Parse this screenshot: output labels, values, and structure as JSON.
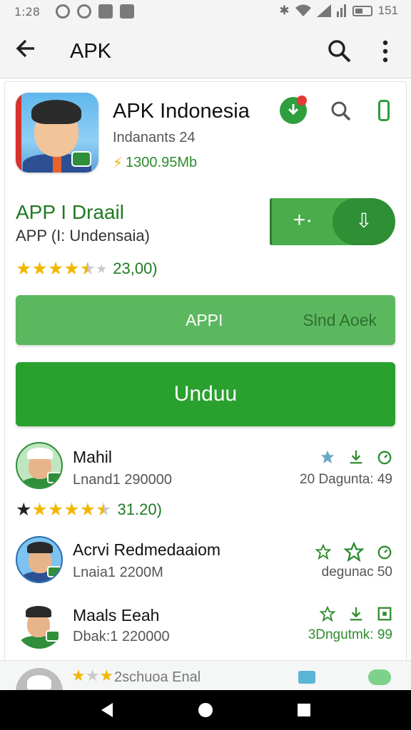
{
  "status_bar": {
    "time": "1:28",
    "battery_text": "151",
    "left_icons": [
      "sync-icon",
      "sync-icon",
      "notification-icon",
      "notification-icon"
    ],
    "right_icons": [
      "bluetooth-icon",
      "wifi-icon",
      "signal-icon",
      "signal-icon",
      "battery-icon"
    ]
  },
  "app_bar": {
    "title": "APK",
    "icons": [
      "back-arrow-icon",
      "search-icon",
      "more-vert-icon"
    ]
  },
  "app": {
    "name": "APK Indonesia",
    "developer": "Indanants 24",
    "size": "1300.95Mb",
    "header_icons": [
      "download-icon",
      "search-icon",
      "phone-icon"
    ]
  },
  "detail": {
    "title": "APP I Draail",
    "subtitle": "APP (I: Undensaia)",
    "rating_value": 4.5,
    "rating_text": "23,00)",
    "split_left_glyph": "+·",
    "split_right_glyph": "⇩"
  },
  "buttons": {
    "app_left": "APPI",
    "app_right": "Slnd Aoek",
    "download": "Unduu"
  },
  "list": [
    {
      "title": "Mahil",
      "subtitle": "Lnand1 290000",
      "right_text": "20 Dagunta: 49",
      "icons": [
        "star-icon",
        "download-icon",
        "timer-icon"
      ],
      "avatar": "green"
    },
    {
      "title": "Acrvi Redmedaaiom",
      "subtitle": "Lnaia1 2200M",
      "right_text": "degunac 50",
      "icons": [
        "star-outline-icon",
        "star-outline-icon",
        "timer-icon"
      ],
      "avatar": "blue"
    },
    {
      "title": "Maals Eeah",
      "subtitle": "Dbak:1 220000",
      "right_text": "3Dngutmk: 99",
      "icons": [
        "star-outline-icon",
        "download-icon",
        "stop-icon"
      ],
      "avatar": "white"
    }
  ],
  "list_rating": {
    "rating_value": 4.5,
    "text": "31.20)"
  },
  "bottom_row": {
    "text": "2schuoa  Enal"
  },
  "nav_bar": {
    "icons": [
      "back-icon",
      "home-icon",
      "recents-icon"
    ]
  }
}
